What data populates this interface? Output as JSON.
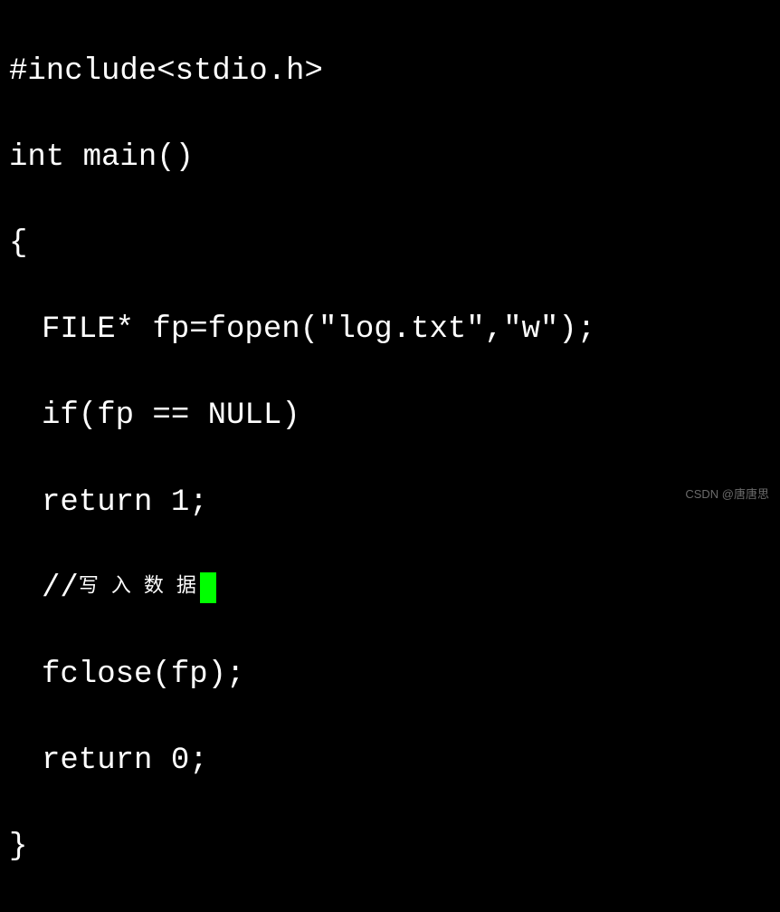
{
  "code": {
    "line1": "#include<stdio.h>",
    "line2": "int main()",
    "line3": "{",
    "line4": "FILE* fp=fopen(\"log.txt\",\"w\");",
    "line5": "if(fp == NULL)",
    "line6": "return 1;",
    "line7_prefix": "//",
    "line7_comment": "写入数据",
    "line8": "fclose(fp);",
    "line9": "return 0;",
    "line10": "}"
  },
  "watermark": "CSDN @唐唐思"
}
